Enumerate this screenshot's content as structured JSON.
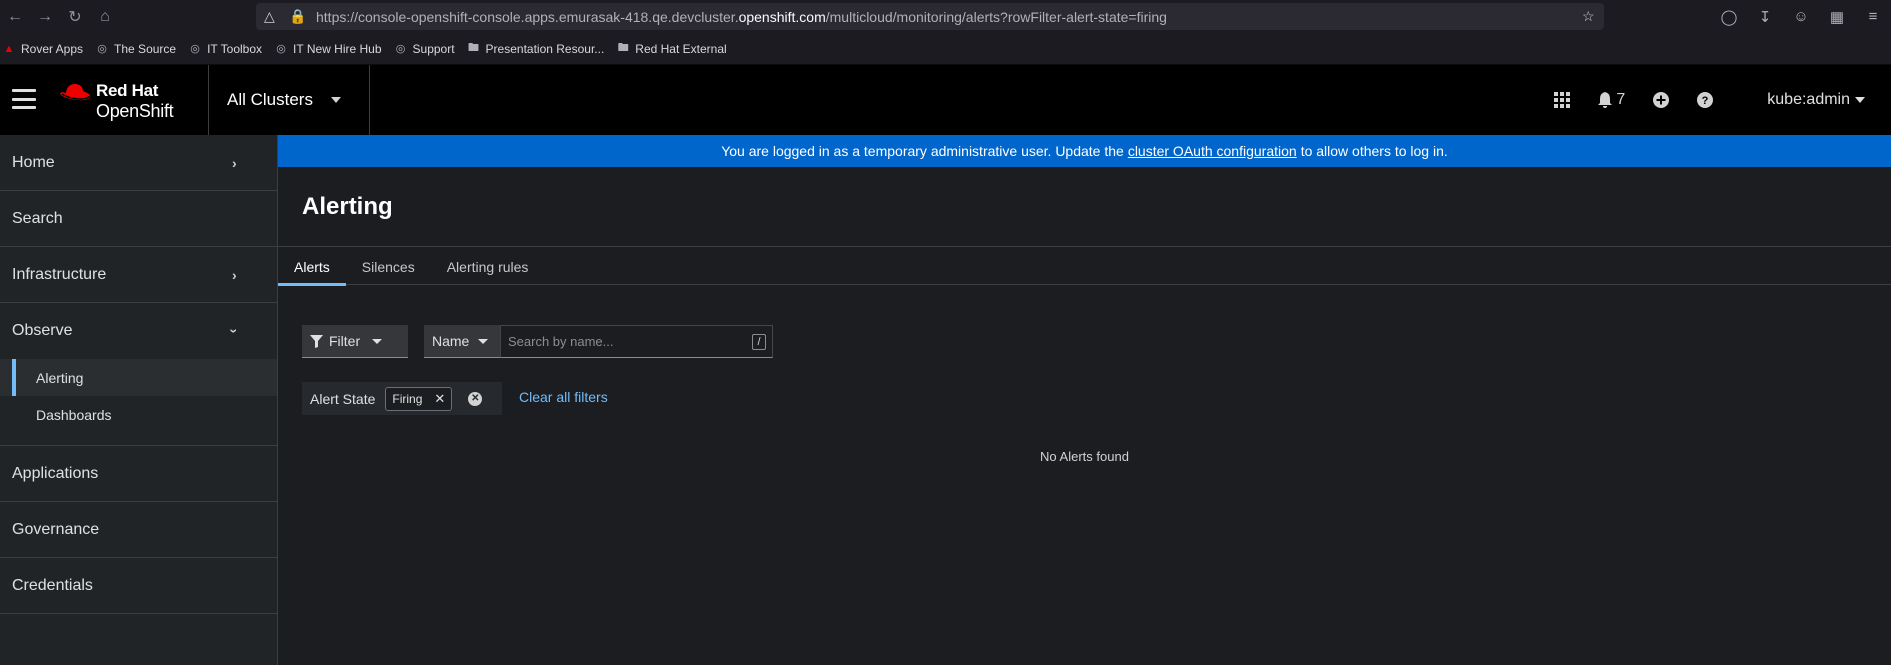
{
  "browser": {
    "url_prefix": "https://console-openshift-console.apps.emurasak-418.qe.devcluster.",
    "url_domain": "openshift.com",
    "url_suffix": "/multicloud/monitoring/alerts?rowFilter-alert-state=firing"
  },
  "bookmarks": [
    {
      "label": "Rover Apps",
      "icon": "redhat-icon"
    },
    {
      "label": "The Source",
      "icon": "globe-icon"
    },
    {
      "label": "IT Toolbox",
      "icon": "globe-icon"
    },
    {
      "label": "IT New Hire Hub",
      "icon": "globe-icon"
    },
    {
      "label": "Support",
      "icon": "globe-icon"
    },
    {
      "label": "Presentation Resour...",
      "icon": "folder-icon"
    },
    {
      "label": "Red Hat External",
      "icon": "folder-icon"
    }
  ],
  "masthead": {
    "logo_line1": "Red Hat",
    "logo_line2": "OpenShift",
    "cluster_selector": "All Clusters",
    "notification_count": "7",
    "user": "kube:admin"
  },
  "sidebar": {
    "items": [
      {
        "label": "Home"
      },
      {
        "label": "Search"
      },
      {
        "label": "Infrastructure"
      },
      {
        "label": "Observe"
      },
      {
        "label": "Applications"
      },
      {
        "label": "Governance"
      },
      {
        "label": "Credentials"
      }
    ],
    "observe_sub": [
      {
        "label": "Alerting"
      },
      {
        "label": "Dashboards"
      }
    ]
  },
  "banner": {
    "text_before": "You are logged in as a temporary administrative user. Update the",
    "link": "cluster OAuth configuration",
    "text_after": "to allow others to log in."
  },
  "page": {
    "title": "Alerting",
    "tabs": [
      {
        "label": "Alerts"
      },
      {
        "label": "Silences"
      },
      {
        "label": "Alerting rules"
      }
    ]
  },
  "toolbar": {
    "filter_label": "Filter",
    "name_label": "Name",
    "search_placeholder": "Search by name...",
    "shortcut": "/"
  },
  "chips": {
    "category": "Alert State",
    "value": "Firing",
    "clear_all": "Clear all filters"
  },
  "empty_state": "No Alerts found"
}
